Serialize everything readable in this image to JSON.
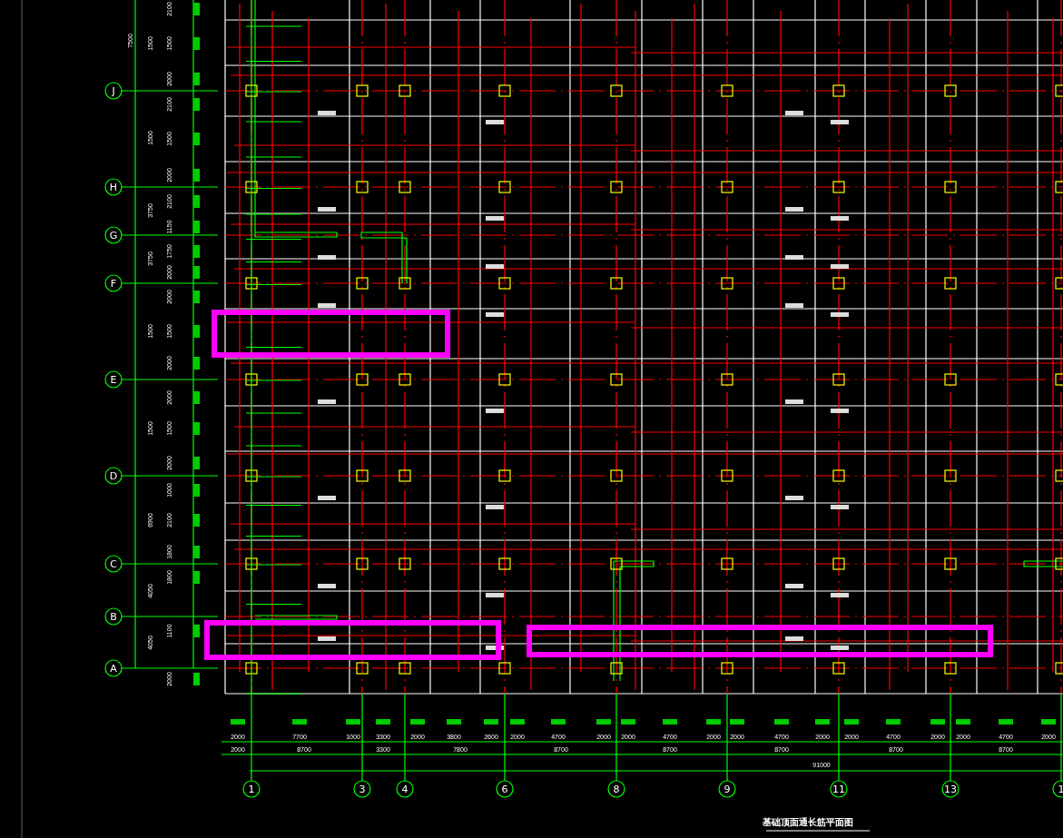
{
  "drawing": {
    "title": "基础顶面通长筋平面图",
    "row_axes": [
      {
        "label": "J"
      },
      {
        "label": "H"
      },
      {
        "label": "G"
      },
      {
        "label": "F"
      },
      {
        "label": "E"
      },
      {
        "label": "D"
      },
      {
        "label": "C"
      },
      {
        "label": "B"
      },
      {
        "label": "A"
      }
    ],
    "column_axes": [
      {
        "label": "1"
      },
      {
        "label": "3"
      },
      {
        "label": "4"
      },
      {
        "label": "6"
      },
      {
        "label": "8"
      },
      {
        "label": "9"
      },
      {
        "label": "11"
      },
      {
        "label": "13"
      },
      {
        "label": "1"
      }
    ],
    "left_dimensions": {
      "overall": [
        "7500"
      ],
      "spans": [
        "1500",
        "1500",
        "3750",
        "3750",
        "1500",
        "1500",
        "6900",
        "4050",
        "4050"
      ],
      "details": [
        "2100",
        "1500",
        "2000",
        "2100",
        "1500",
        "2000",
        "2100",
        "1150",
        "1750",
        "2000",
        "2000",
        "1500",
        "2000",
        "2000",
        "1500",
        "2000",
        "1000",
        "2100",
        "1800",
        "1800",
        "1100",
        "2000"
      ]
    },
    "bottom_dimensions": {
      "details": [
        "2000",
        "7700",
        "1000",
        "3300",
        "2000",
        "3800",
        "2600",
        "2000",
        "4700",
        "2000",
        "2000",
        "4700",
        "2000",
        "2000",
        "4700",
        "2000",
        "2000",
        "4700",
        "2000",
        "2000",
        "4700",
        "2000"
      ],
      "spans": [
        "2000",
        "8700",
        "3300",
        "7800",
        "8700",
        "8700",
        "8700",
        "8700",
        "8700"
      ],
      "total": [
        "91000"
      ]
    }
  }
}
